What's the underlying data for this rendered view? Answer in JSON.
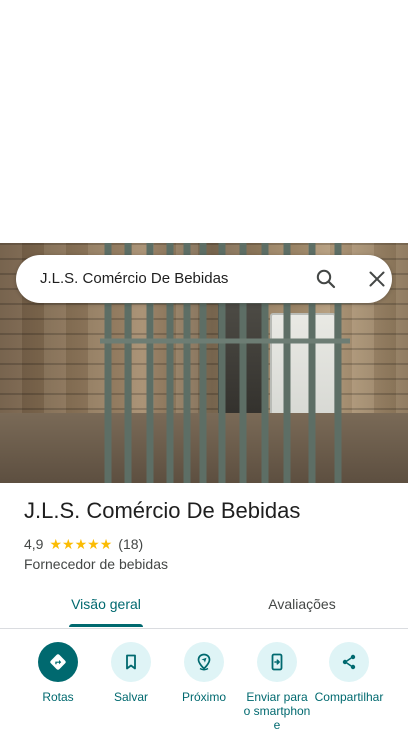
{
  "search": {
    "query": "J.L.S. Comércio De Bebidas"
  },
  "place": {
    "name": "J.L.S. Comércio De Bebidas",
    "rating": "4,9",
    "stars": 5,
    "review_count": "(18)",
    "category": "Fornecedor de bebidas"
  },
  "tabs": [
    {
      "label": "Visão geral",
      "selected": true
    },
    {
      "label": "Avaliações",
      "selected": false
    }
  ],
  "actions": [
    {
      "label": "Rotas",
      "icon": "directions-icon"
    },
    {
      "label": "Salvar",
      "icon": "bookmark-icon"
    },
    {
      "label": "Próximo",
      "icon": "nearby-icon"
    },
    {
      "label": "Enviar para o smartphone",
      "icon": "send-to-phone-icon"
    },
    {
      "label": "Compartilhar",
      "icon": "share-icon"
    }
  ],
  "colors": {
    "accent": "#00696f",
    "action_bg": "#dff4f6",
    "star": "#fbbc04"
  }
}
